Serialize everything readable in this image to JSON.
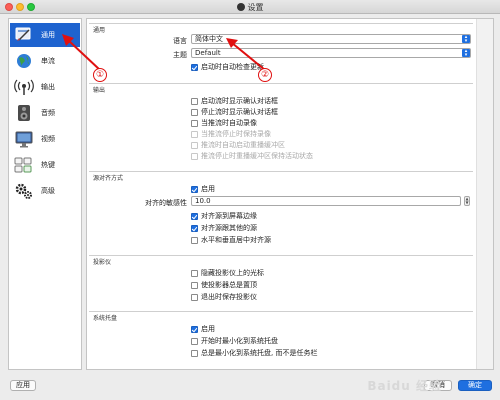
{
  "window": {
    "title": "设置"
  },
  "sidebar": {
    "items": [
      {
        "label": "通用",
        "icon": "general-settings-icon",
        "active": true
      },
      {
        "label": "串流",
        "icon": "stream-globe-icon"
      },
      {
        "label": "输出",
        "icon": "output-broadcast-icon"
      },
      {
        "label": "音频",
        "icon": "audio-speaker-icon"
      },
      {
        "label": "视频",
        "icon": "video-monitor-icon"
      },
      {
        "label": "热键",
        "icon": "hotkeys-keyboard-icon"
      },
      {
        "label": "高级",
        "icon": "advanced-gears-icon"
      }
    ]
  },
  "general": {
    "title": "通用",
    "language_label": "语言",
    "language_value": "简体中文",
    "theme_label": "主题",
    "theme_value": "Default",
    "check_updates_label": "启动时自动检查更新"
  },
  "output": {
    "title": "输出",
    "options": [
      {
        "label": "启动流时显示确认对话框",
        "checked": false,
        "disabled": false
      },
      {
        "label": "停止流时显示确认对话框",
        "checked": false,
        "disabled": false
      },
      {
        "label": "当推流时自动录像",
        "checked": false,
        "disabled": false
      },
      {
        "label": "当推流停止时保持录像",
        "checked": false,
        "disabled": true
      },
      {
        "label": "推流时自动启动重播缓冲区",
        "checked": false,
        "disabled": true
      },
      {
        "label": "推流停止时重播缓冲区保持活动状态",
        "checked": false,
        "disabled": true
      }
    ]
  },
  "snapping": {
    "title": "源对齐方式",
    "enable_label": "启用",
    "sensitivity_label": "对齐的敏感性",
    "sensitivity_value": "10.0",
    "options": [
      {
        "label": "对齐源到屏幕边缘",
        "checked": true
      },
      {
        "label": "对齐源跟其他的源",
        "checked": true
      },
      {
        "label": "水平和垂直居中对齐源",
        "checked": false
      }
    ]
  },
  "projectors": {
    "title": "投影仪",
    "options": [
      {
        "label": "隐藏投影仪上的光标",
        "checked": false
      },
      {
        "label": "使投影器总是置顶",
        "checked": false
      },
      {
        "label": "退出时保存投影仪",
        "checked": false
      }
    ]
  },
  "tray": {
    "title": "系统托盘",
    "options": [
      {
        "label": "启用",
        "checked": true
      },
      {
        "label": "开始时最小化到系统托盘",
        "checked": false
      },
      {
        "label": "总是最小化到系统托盘, 而不是任务栏",
        "checked": false
      }
    ]
  },
  "buttons": {
    "apply": "应用",
    "cancel": "取消",
    "ok": "确定"
  },
  "annotations": {
    "marker1": "①",
    "marker2": "②"
  },
  "watermark": {
    "text": "Baidu 经验"
  },
  "colors": {
    "accent": "#1e6fe0",
    "annotation": "#e01010",
    "sidebar_active": "#1e63cf"
  }
}
